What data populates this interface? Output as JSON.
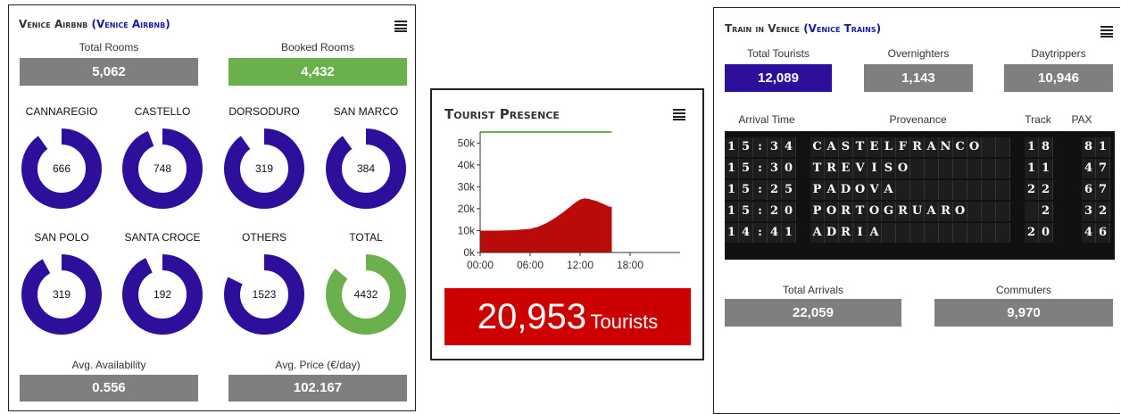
{
  "airbnb": {
    "title": "Venice Airbnb",
    "subtitle": "(Venice Airbnb)",
    "total_rooms_label": "Total Rooms",
    "total_rooms_value": "5,062",
    "booked_rooms_label": "Booked Rooms",
    "booked_rooms_value": "4,432",
    "districts": [
      {
        "name": "CANNAREGIO",
        "value": "666",
        "fraction": 0.9
      },
      {
        "name": "CASTELLO",
        "value": "748",
        "fraction": 0.94
      },
      {
        "name": "DORSODURO",
        "value": "319",
        "fraction": 0.9
      },
      {
        "name": "SAN MARCO",
        "value": "384",
        "fraction": 0.9
      },
      {
        "name": "SAN POLO",
        "value": "319",
        "fraction": 0.92
      },
      {
        "name": "SANTA CROCE",
        "value": "192",
        "fraction": 0.93
      },
      {
        "name": "OTHERS",
        "value": "1523",
        "fraction": 0.82
      },
      {
        "name": "TOTAL",
        "value": "4432",
        "fraction": 0.86
      }
    ],
    "avg_availability_label": "Avg. Availability",
    "avg_availability_value": "0.556",
    "avg_price_label": "Avg. Price (€/day)",
    "avg_price_value": "102.167",
    "colors": {
      "gray": "#7f7f7f",
      "green": "#6ab04c",
      "purple": "#2d0f9c"
    }
  },
  "presence": {
    "title": "Tourist Presence",
    "total_value": "20,953",
    "total_unit": "Tourists",
    "colors": {
      "area": "#bb0a0a",
      "threshold": "#6ab04c",
      "banner": "#cc0000"
    },
    "chart_data": {
      "type": "area",
      "title": "",
      "xlabel": "",
      "ylabel": "",
      "x_ticks": [
        "00:00",
        "06:00",
        "12:00",
        "18:00"
      ],
      "y_ticks": [
        "0k",
        "10k",
        "20k",
        "30k",
        "40k",
        "50k"
      ],
      "xlim": [
        0,
        24
      ],
      "ylim": [
        0,
        55000
      ],
      "threshold": 55000,
      "x": [
        0,
        2,
        4,
        6,
        7,
        8,
        9,
        10,
        11,
        11.5,
        12,
        12.5,
        13,
        14,
        15,
        15.5,
        15.8
      ],
      "values": [
        10000,
        10000,
        10200,
        10800,
        11800,
        13500,
        15800,
        18500,
        21500,
        23000,
        24200,
        24700,
        24500,
        23500,
        21800,
        20953,
        20953
      ]
    }
  },
  "trains": {
    "title": "Train in Venice",
    "subtitle": "(Venice Trains)",
    "total_tourists_label": "Total Tourists",
    "total_tourists_value": "12,089",
    "overnighters_label": "Overnighters",
    "overnighters_value": "1,143",
    "daytrippers_label": "Daytrippers",
    "daytrippers_value": "10,946",
    "columns": [
      "Arrival Time",
      "Provenance",
      "Track",
      "PAX"
    ],
    "rows": [
      {
        "time": "15:34",
        "provenance": "CASTELFRANCO",
        "track": "18",
        "pax": "81"
      },
      {
        "time": "15:30",
        "provenance": "TREVISO",
        "track": "11",
        "pax": "47"
      },
      {
        "time": "15:25",
        "provenance": "PADOVA",
        "track": "22",
        "pax": "67"
      },
      {
        "time": "15:20",
        "provenance": "PORTOGRUARO",
        "track": "2",
        "pax": "32"
      },
      {
        "time": "14:41",
        "provenance": "ADRIA",
        "track": "20",
        "pax": "46"
      }
    ],
    "total_arrivals_label": "Total Arrivals",
    "total_arrivals_value": "22,059",
    "commuters_label": "Commuters",
    "commuters_value": "9,970",
    "colors": {
      "gray": "#7f7f7f",
      "purple": "#2d0f9c"
    }
  }
}
